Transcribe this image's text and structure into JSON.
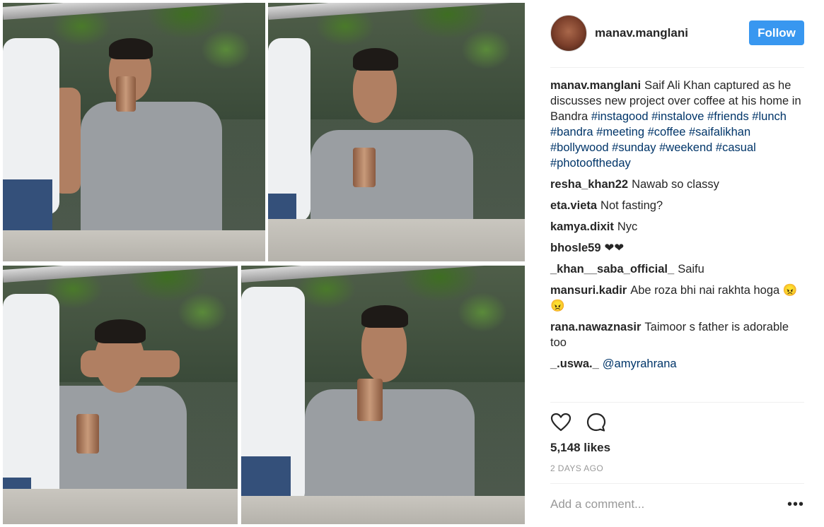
{
  "post": {
    "author": "manav.manglani",
    "follow_label": "Follow",
    "caption": {
      "user": "manav.manglani",
      "text": "Saif Ali Khan captured as he discusses new project over coffee at his home in Bandra",
      "hashtags": "#instagood #instalove #friends #lunch #bandra #meeting #coffee #saifalikhan #bollywood #sunday #weekend #casual #photooftheday"
    },
    "comments": [
      {
        "user": "resha_khan22",
        "text": "Nawab so classy"
      },
      {
        "user": "eta.vieta",
        "text": "Not fasting?"
      },
      {
        "user": "kamya.dixit",
        "text": "Nyc"
      },
      {
        "user": "bhosle59",
        "text": "❤❤"
      },
      {
        "user": "_khan__saba_official_",
        "text": "Saifu"
      },
      {
        "user": "mansuri.kadir",
        "text": "Abe roza bhi nai rakhta hoga 😠😠"
      },
      {
        "user": "rana.nawaznasir",
        "text": "Taimoor s father is adorable too"
      },
      {
        "user": "_.uswa._",
        "text": "@amyrahrana"
      }
    ],
    "likes": "5,148 likes",
    "timestamp": "2 DAYS AGO",
    "comment_placeholder": "Add a comment...",
    "icons": {
      "like": "heart-icon",
      "comment": "comment-icon",
      "more": "more-options-icon"
    },
    "colors": {
      "follow_bg": "#3897f0",
      "hashtag": "#003569",
      "muted": "#999999"
    }
  }
}
